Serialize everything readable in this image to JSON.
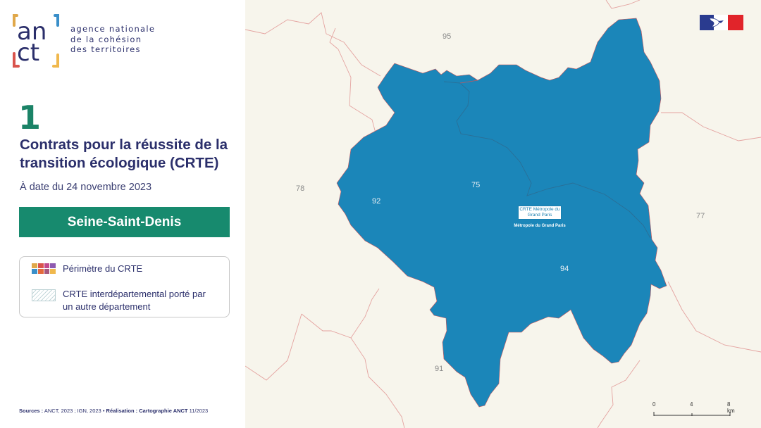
{
  "brand": {
    "logo_text": "anct",
    "tagline": [
      "agence nationale",
      "de la cohésion",
      "des territoires"
    ],
    "color_primary": "#2b2f6b",
    "color_accent": "#1b8367"
  },
  "header": {
    "number": "1",
    "title": "Contrats pour la réussite de la transition écologique (CRTE)",
    "date": "À date du 24 novembre 2023"
  },
  "department_button": {
    "label": "Seine-Saint-Denis",
    "color": "#178a6e"
  },
  "legend": {
    "items": [
      {
        "label": "Périmètre du CRTE",
        "icon": "colored-grid-swatch"
      },
      {
        "label": "CRTE interdépartemental porté par un autre département",
        "icon": "hatched-swatch"
      }
    ],
    "swatch_colors": [
      "#e0a84a",
      "#d9544d",
      "#c24a8e",
      "#8e5ab0",
      "#3a8fc9",
      "#e46a3c",
      "#a6587f",
      "#f0b84d"
    ]
  },
  "map": {
    "region_color": "#1b86b9",
    "department_labels": [
      {
        "code": "95"
      },
      {
        "code": "78"
      },
      {
        "code": "92"
      },
      {
        "code": "75"
      },
      {
        "code": "94"
      },
      {
        "code": "77"
      },
      {
        "code": "91"
      }
    ],
    "crte_label": "CRTE Métropole du Grand Paris",
    "crte_sublabel": "Métropole du Grand Paris"
  },
  "scale": {
    "ticks": [
      "0",
      "4",
      "8 km"
    ]
  },
  "sources": {
    "prefix": "Sources :",
    "text": " ANCT, 2023 ; IGN, 2023 • ",
    "realisation_prefix": "Réalisation :",
    "realisation": " Cartographie ANCT",
    "date": " 11/2023"
  },
  "flag_icon": "marianne-flag-icon"
}
